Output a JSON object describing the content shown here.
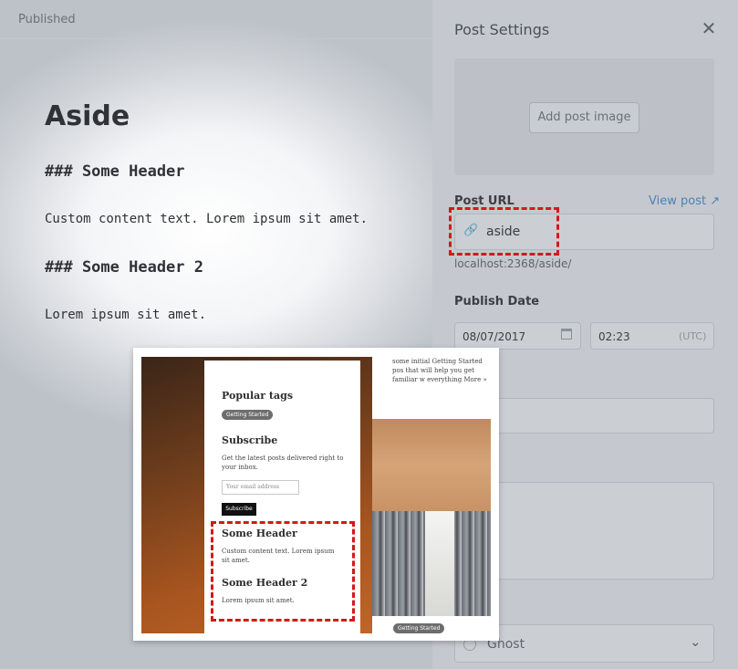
{
  "editor": {
    "status": "Published",
    "title": "Aside",
    "lines": [
      "### Some Header",
      "Custom content text. Lorem ipsum sit amet.",
      "### Some Header 2",
      "Lorem ipsum sit amet."
    ]
  },
  "settings": {
    "title": "Post Settings",
    "add_image": "Add post image",
    "url_label": "Post URL",
    "view_post": "View post",
    "url_value": "aside",
    "url_hint": "localhost:2368/aside/",
    "publish_label": "Publish Date",
    "date": "08/07/2017",
    "time": "02:23",
    "timezone": "(UTC)",
    "author": "Ghost"
  },
  "preview": {
    "intro": "some initial Getting Started pos that will help you get familiar w everything More »",
    "popular_tags": "Popular tags",
    "tag": "Getting Started",
    "subscribe_title": "Subscribe",
    "subscribe_text": "Get the latest posts delivered right to your inbox.",
    "email_placeholder": "Your email address",
    "subscribe_button": "Subscribe",
    "header1": "Some Header",
    "body1": "Custom content text. Lorem ipsum sit amet.",
    "header2": "Some Header 2",
    "body2": "Lorem ipsum sit amet.",
    "bottom_tag": "Getting Started"
  },
  "colors": {
    "highlight": "#d11a1a",
    "link": "#4a82b6"
  }
}
